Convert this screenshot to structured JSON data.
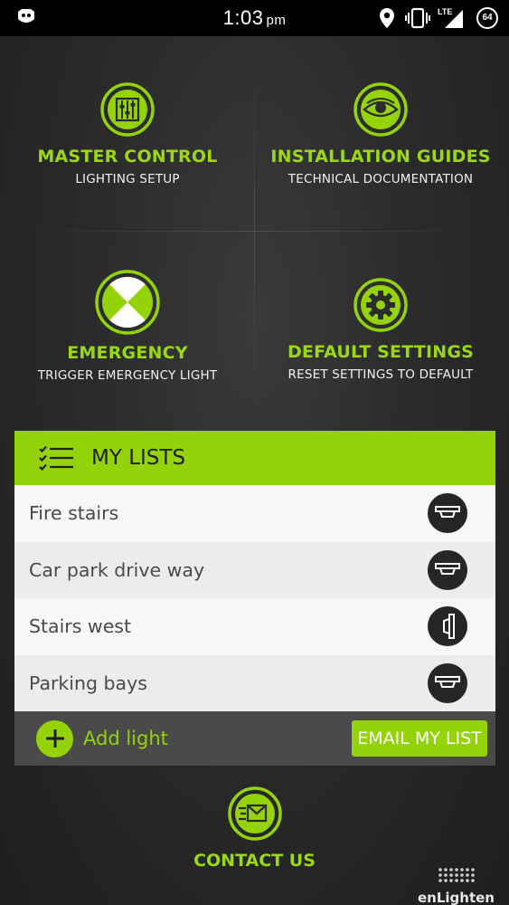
{
  "status_bar": {
    "time": "1:03",
    "ampm": "pm",
    "network": "LTE",
    "battery": "64",
    "icons": [
      "app-notification-icon",
      "location-icon",
      "vibrate-icon",
      "signal-icon",
      "battery-icon"
    ]
  },
  "tiles": {
    "master_control": {
      "title": "MASTER CONTROL",
      "subtitle": "LIGHTING SETUP",
      "icon": "sliders-icon"
    },
    "installation_guides": {
      "title": "INSTALLATION GUIDES",
      "subtitle": "TECHNICAL DOCUMENTATION",
      "icon": "eye-icon"
    },
    "emergency": {
      "title": "EMERGENCY",
      "subtitle": "TRIGGER EMERGENCY LIGHT",
      "icon": "emergency-x-icon"
    },
    "default_settings": {
      "title": "DEFAULT SETTINGS",
      "subtitle": "RESET SETTINGS TO DEFAULT",
      "icon": "gear-icon"
    }
  },
  "my_lists": {
    "header": "MY LISTS",
    "items": [
      {
        "name": "Fire stairs",
        "icon": "ceiling-light-icon"
      },
      {
        "name": "Car park drive way",
        "icon": "ceiling-light-icon"
      },
      {
        "name": "Stairs west",
        "icon": "wall-light-icon"
      },
      {
        "name": "Parking bays",
        "icon": "ceiling-light-icon"
      }
    ],
    "add_label": "Add light",
    "email_label": "EMAIL MY LIST"
  },
  "contact": {
    "title": "CONTACT US",
    "icon": "fast-mail-icon"
  },
  "brand": "enLighten",
  "colors": {
    "accent": "#94d20a",
    "background": "#2b2b2b",
    "row_light": "#f7f7f7",
    "row_alt": "#ececec",
    "footer": "#4a4a4a"
  }
}
